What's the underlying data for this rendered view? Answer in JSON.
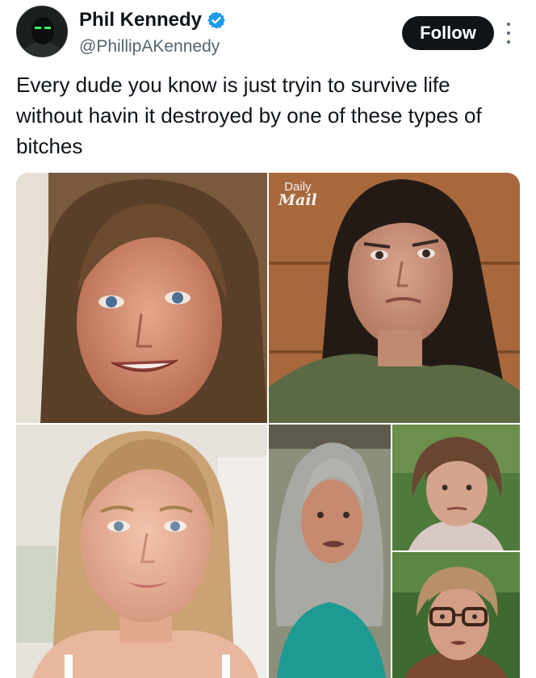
{
  "post": {
    "author": {
      "display_name": "Phil Kennedy",
      "handle": "@PhillipAKennedy",
      "verified": true,
      "avatar_icon": "masked-face-avatar"
    },
    "follow_label": "Follow",
    "more_icon": "vertical-ellipsis-icon",
    "text": "Every dude you know is just tryin to survive life without havin it destroyed by one of these types of bitches",
    "media": {
      "watermark_line1": "Daily",
      "watermark_line2": "Mail",
      "photos": [
        "woman-brown-hair-smiling-photo",
        "woman-dark-hair-frowning-photo",
        "woman-blonde-bob-photo",
        "woman-gray-curly-hair-photo",
        "older-woman-short-brown-hair-photo",
        "woman-glasses-outdoors-photo"
      ]
    }
  },
  "colors": {
    "text_primary": "#0f1419",
    "text_secondary": "#536471",
    "verified_blue": "#1d9bf0",
    "follow_bg": "#0f1419",
    "follow_text": "#ffffff"
  }
}
